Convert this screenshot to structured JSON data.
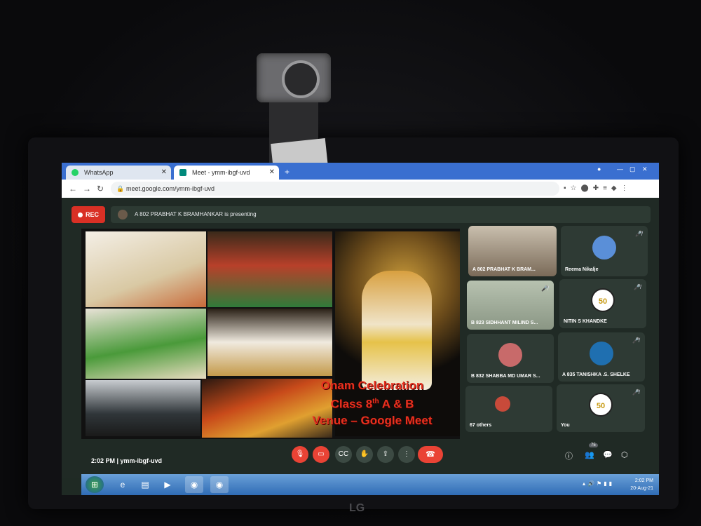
{
  "browser": {
    "tabs": [
      {
        "label": "WhatsApp",
        "icon": "whatsapp-icon"
      },
      {
        "label": "Meet - ymm-ibgf-uvd",
        "icon": "meet-icon"
      }
    ],
    "url": "meet.google.com/ymm-ibgf-uvd"
  },
  "meet": {
    "rec_label": "REC",
    "presenting_text": "A 802 PRABHAT K BRAMHANKAR is presenting",
    "slide": {
      "line1": "Onam Celebration",
      "line2_pre": "Class 8",
      "line2_sup": "th",
      "line2_post": " A & B",
      "line3": "Venue – Google Meet"
    },
    "participants": [
      {
        "name": "A 802 PRABHAT K BRAM..."
      },
      {
        "name": "Reema Nikalje"
      },
      {
        "name": "B 823 SIDHHANT MILIND S..."
      },
      {
        "name": "NITIN S KHANDKE"
      },
      {
        "name": "B 832 SHABBA MD UMAR S..."
      },
      {
        "name": "A 835 TANISHKA .S. SHELKE"
      },
      {
        "name": "67 others"
      },
      {
        "name": "You"
      }
    ],
    "badge_text": "50",
    "time_and_code": "2:02 PM  |  ymm-ibgf-uvd",
    "people_count": "75"
  },
  "taskbar": {
    "clock_time": "2:02 PM",
    "clock_date": "20-Aug-21"
  },
  "monitor_brand": "LG"
}
